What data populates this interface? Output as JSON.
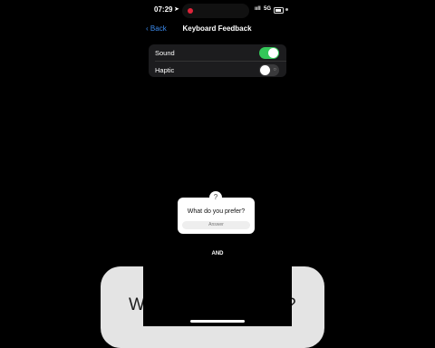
{
  "background": {
    "card_text": "W",
    "card_text_tail": "?"
  },
  "status_bar": {
    "time": "07:29",
    "signal": "ııll",
    "network": "5G"
  },
  "nav": {
    "back_label": "Back",
    "title": "Keyboard Feedback"
  },
  "settings": {
    "rows": [
      {
        "label": "Sound",
        "enabled": true
      },
      {
        "label": "Haptic",
        "enabled": false
      }
    ]
  },
  "question": {
    "prompt": "What do you prefer?",
    "answer_placeholder": "Answer"
  },
  "overlay": {
    "and_text": "AND"
  },
  "colors": {
    "accent": "#3c8cf0",
    "toggle_on": "#34c759",
    "record": "#e0243a"
  }
}
